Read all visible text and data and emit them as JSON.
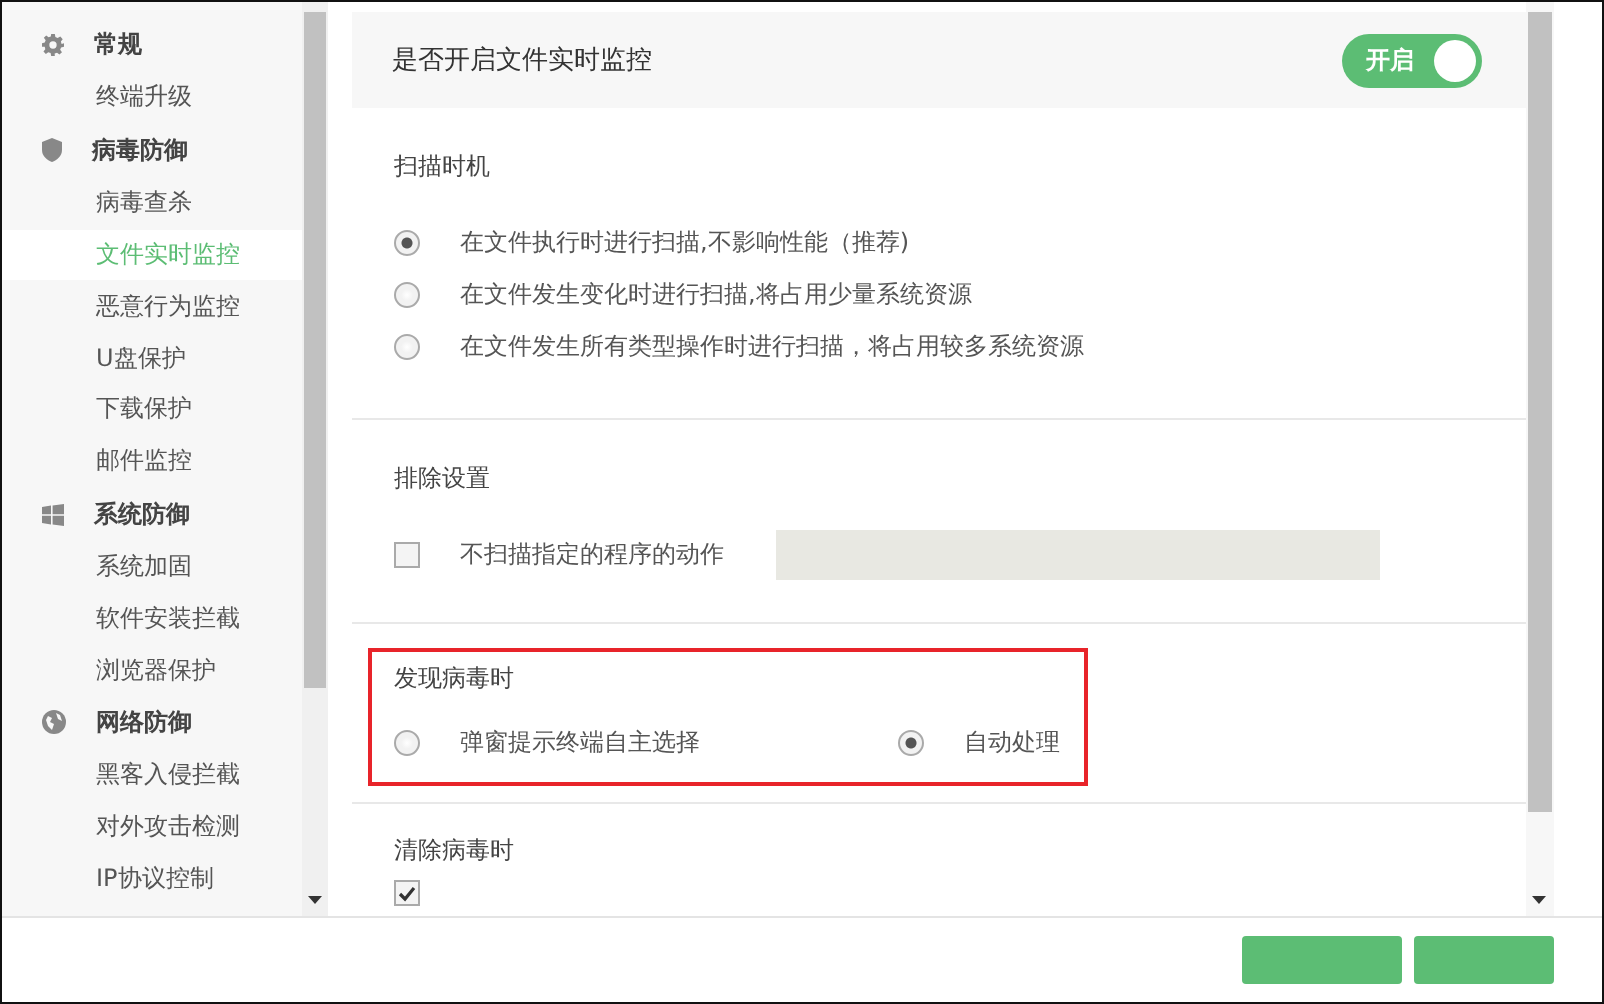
{
  "sidebar": {
    "groups": [
      {
        "title": "常规",
        "items": [
          {
            "label": "终端升级",
            "selected": false
          }
        ]
      },
      {
        "title": "病毒防御",
        "items": [
          {
            "label": "病毒查杀",
            "selected": false
          },
          {
            "label": "文件实时监控",
            "selected": true
          },
          {
            "label": "恶意行为监控",
            "selected": false
          },
          {
            "label": "U盘保护",
            "selected": false
          },
          {
            "label": "下载保护",
            "selected": false
          },
          {
            "label": "邮件监控",
            "selected": false
          }
        ]
      },
      {
        "title": "系统防御",
        "items": [
          {
            "label": "系统加固",
            "selected": false
          },
          {
            "label": "软件安装拦截",
            "selected": false
          },
          {
            "label": "浏览器保护",
            "selected": false
          }
        ]
      },
      {
        "title": "网络防御",
        "items": [
          {
            "label": "黑客入侵拦截",
            "selected": false
          },
          {
            "label": "对外攻击检测",
            "selected": false
          },
          {
            "label": "IP协议控制",
            "selected": false
          }
        ]
      }
    ]
  },
  "main": {
    "realtime": {
      "label": "是否开启文件实时监控",
      "toggle": {
        "on": true,
        "label": "开启"
      }
    },
    "scan_timing": {
      "title": "扫描时机",
      "options": [
        {
          "label": "在文件执行时进行扫描,不影响性能（推荐)",
          "selected": true
        },
        {
          "label": "在文件发生变化时进行扫描,将占用少量系统资源",
          "selected": false
        },
        {
          "label": "在文件发生所有类型操作时进行扫描，将占用较多系统资源",
          "selected": false
        }
      ]
    },
    "exclusion": {
      "title": "排除设置",
      "checkbox": {
        "label": "不扫描指定的程序的动作",
        "checked": false
      }
    },
    "on_detect": {
      "title": "发现病毒时",
      "highlighted": true,
      "options": [
        {
          "label": "弹窗提示终端自主选择",
          "selected": false
        },
        {
          "label": "自动处理",
          "selected": true
        }
      ]
    },
    "on_clean": {
      "title": "清除病毒时",
      "checkbox": {
        "checked": true
      }
    }
  }
}
